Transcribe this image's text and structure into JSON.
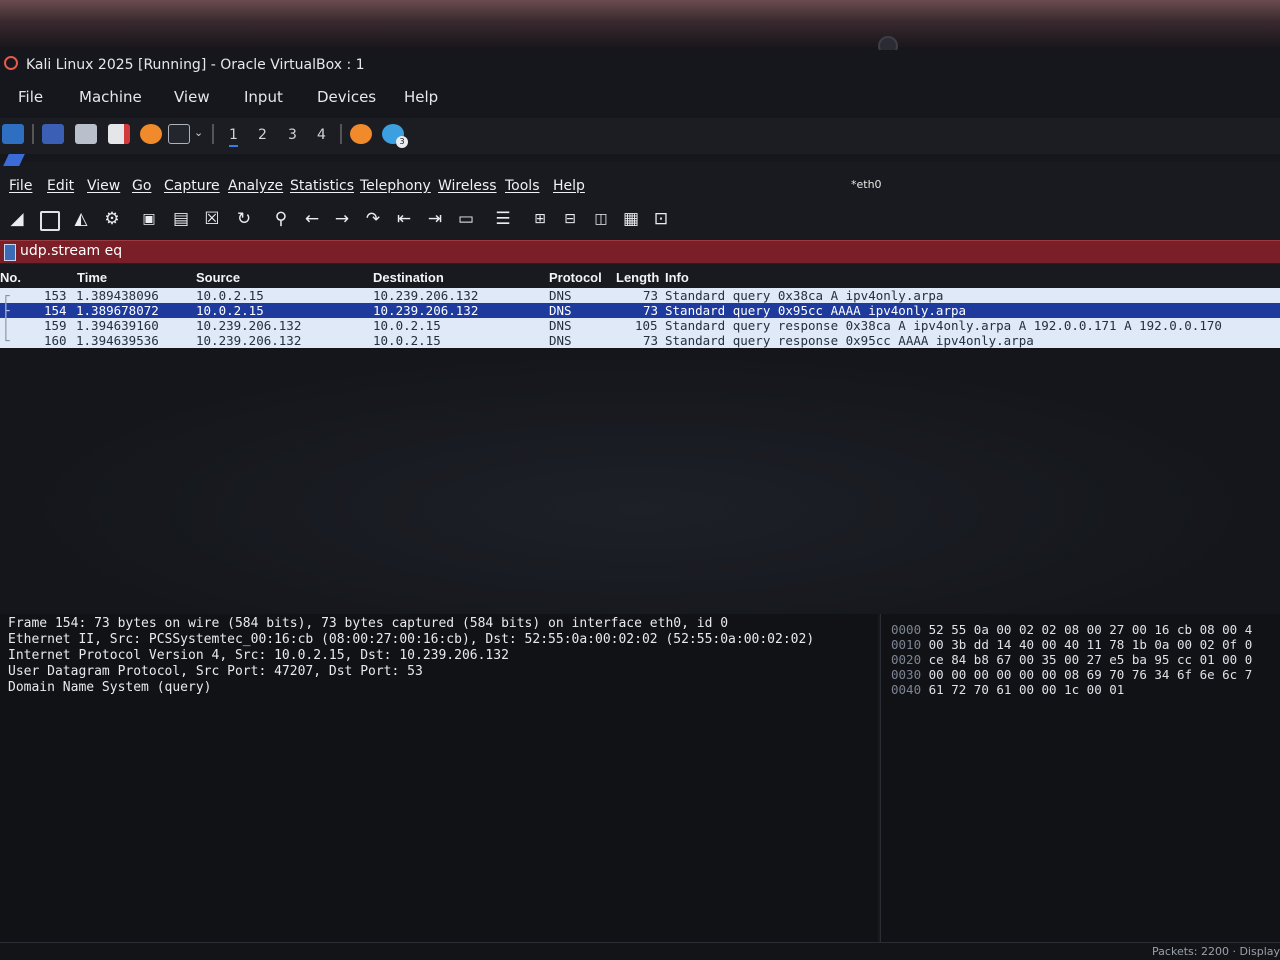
{
  "vbox": {
    "title": "Kali Linux 2025 [Running] - Oracle VirtualBox : 1",
    "menu": [
      "File",
      "Machine",
      "View",
      "Input",
      "Devices",
      "Help"
    ]
  },
  "kali_panel": {
    "workspaces": [
      "1",
      "2",
      "3",
      "4"
    ],
    "badge": "3"
  },
  "wireshark": {
    "menu": [
      "File",
      "Edit",
      "View",
      "Go",
      "Capture",
      "Analyze",
      "Statistics",
      "Telephony",
      "Wireless",
      "Tools",
      "Help"
    ],
    "interface_title": "*eth0",
    "filter_value": "udp.stream eq",
    "columns": [
      "No.",
      "Time",
      "Source",
      "Destination",
      "Protocol",
      "Length",
      "Info"
    ],
    "packets": [
      {
        "no": "153",
        "time": "1.389438096",
        "src": "10.0.2.15",
        "dst": "10.239.206.132",
        "proto": "DNS",
        "len": "73",
        "info": "Standard query 0x38ca A ipv4only.arpa",
        "selected": false
      },
      {
        "no": "154",
        "time": "1.389678072",
        "src": "10.0.2.15",
        "dst": "10.239.206.132",
        "proto": "DNS",
        "len": "73",
        "info": "Standard query 0x95cc AAAA ipv4only.arpa",
        "selected": true
      },
      {
        "no": "159",
        "time": "1.394639160",
        "src": "10.239.206.132",
        "dst": "10.0.2.15",
        "proto": "DNS",
        "len": "105",
        "info": "Standard query response 0x38ca A ipv4only.arpa A 192.0.0.171 A 192.0.0.170",
        "selected": false
      },
      {
        "no": "160",
        "time": "1.394639536",
        "src": "10.239.206.132",
        "dst": "10.0.2.15",
        "proto": "DNS",
        "len": "73",
        "info": "Standard query response 0x95cc AAAA ipv4only.arpa",
        "selected": false
      }
    ],
    "details": [
      "Frame 154: 73 bytes on wire (584 bits), 73 bytes captured (584 bits) on interface eth0, id 0",
      "Ethernet II, Src: PCSSystemtec_00:16:cb (08:00:27:00:16:cb), Dst: 52:55:0a:00:02:02 (52:55:0a:00:02:02)",
      "Internet Protocol Version 4, Src: 10.0.2.15, Dst: 10.239.206.132",
      "User Datagram Protocol, Src Port: 47207, Dst Port: 53",
      "Domain Name System (query)"
    ],
    "hex": [
      {
        "offset": "0000",
        "bytes": "52 55 0a 00 02 02 08 00  27 00 16 cb 08 00 4"
      },
      {
        "offset": "0010",
        "bytes": "00 3b dd 14 40 00 40 11  78 1b 0a 00 02 0f 0"
      },
      {
        "offset": "0020",
        "bytes": "ce 84 b8 67 00 35 00 27  e5 ba 95 cc 01 00 0"
      },
      {
        "offset": "0030",
        "bytes": "00 00 00 00 00 00 08 69  70 76 34 6f 6e 6c 7"
      },
      {
        "offset": "0040",
        "bytes": "61 72 70 61 00 00 1c 00  01"
      }
    ],
    "status_right": "Packets: 2200 · Display"
  },
  "colors": {
    "selected_row": "#1d3a9c",
    "row_bg": "#dfe9f7",
    "filter_bg": "#7a1f27"
  }
}
